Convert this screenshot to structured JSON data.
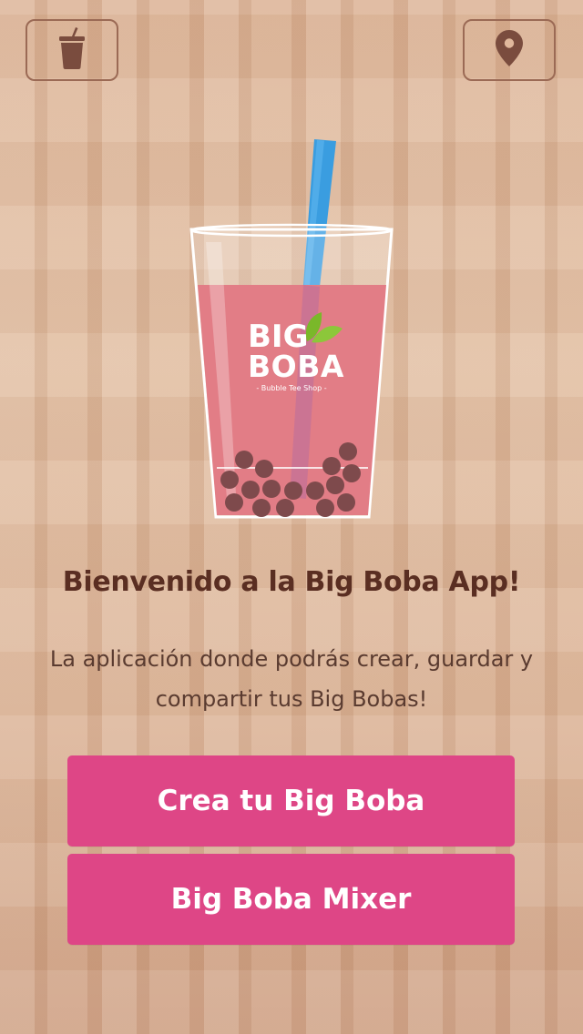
{
  "header": {
    "left_icon": "drink-cup-icon",
    "right_icon": "location-pin-icon"
  },
  "logo": {
    "line1": "BIG",
    "line2": "BOBA",
    "tagline": "- Bubble Tee Shop -"
  },
  "welcome": {
    "title": "Bienvenido a la Big Boba App!",
    "description": "La aplicación donde podrás crear, guardar y compartir tus Big Bobas!"
  },
  "buttons": {
    "create": "Crea tu Big Boba",
    "mixer": "Big Boba Mixer"
  },
  "colors": {
    "accent": "#de4686",
    "text_dark": "#5a2e22",
    "straw": "#3a9de0",
    "tea": "#e27d86",
    "pearl": "#7e4a4c",
    "leaf": "#7ab82a"
  }
}
